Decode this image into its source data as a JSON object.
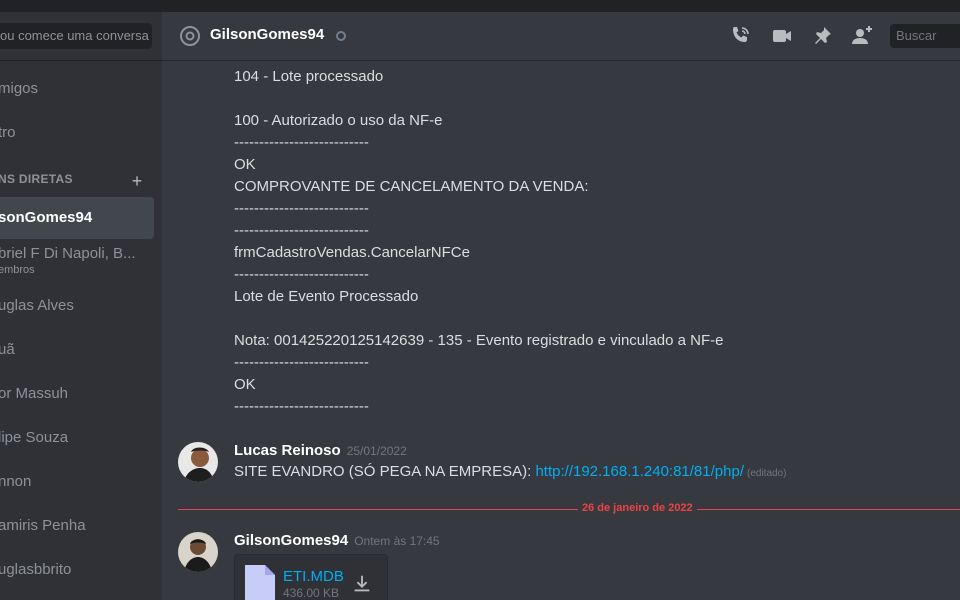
{
  "sidebar": {
    "search_placeholder": "ou comece uma conversa",
    "nav": [
      {
        "label": "migos"
      },
      {
        "label": "tro"
      }
    ],
    "dm_header": "NS DIRETAS",
    "dm_add": "+",
    "dms": [
      {
        "name": "sonGomes94",
        "selected": true
      },
      {
        "name": "briel F Di Napoli, B...",
        "sub": "embros"
      },
      {
        "name": "uglas Alves"
      },
      {
        "name": "uã"
      },
      {
        "name": "or Massuh"
      },
      {
        "name": "lipe Souza"
      },
      {
        "name": "nnon"
      },
      {
        "name": "amiris Penha"
      },
      {
        "name": "uglasbbrito"
      }
    ]
  },
  "header": {
    "channel_name": "GilsonGomes94",
    "search_placeholder": "Buscar"
  },
  "messages": {
    "continuation_lines": [
      "104 - Lote processado",
      "",
      "100 - Autorizado o uso da NF-e",
      "---------------------------",
      "OK",
      "COMPROVANTE DE CANCELAMENTO DA VENDA:",
      "---------------------------",
      "---------------------------",
      "frmCadastroVendas.CancelarNFCe",
      "---------------------------",
      "Lote de Evento Processado",
      "",
      "Nota: 001425220125142639 - 135 - Evento registrado e vinculado a NF-e",
      "---------------------------",
      "OK",
      "---------------------------"
    ],
    "msg1": {
      "author": "Lucas Reinoso",
      "timestamp": "25/01/2022",
      "text": "SITE EVANDRO (SÓ PEGA NA EMPRESA): ",
      "link": "http://192.168.1.240:81/81/php/",
      "edited": "(editado)"
    },
    "date_divider": "26 de janeiro de 2022",
    "msg2": {
      "author": "GilsonGomes94",
      "timestamp": "Ontem às 17:45",
      "file_name": "ETI.MDB",
      "file_size": "436.00 KB"
    }
  },
  "colors": {
    "background": "#36393f",
    "sidebar": "#2f3136",
    "link": "#00aff4",
    "divider": "#ed4245"
  }
}
